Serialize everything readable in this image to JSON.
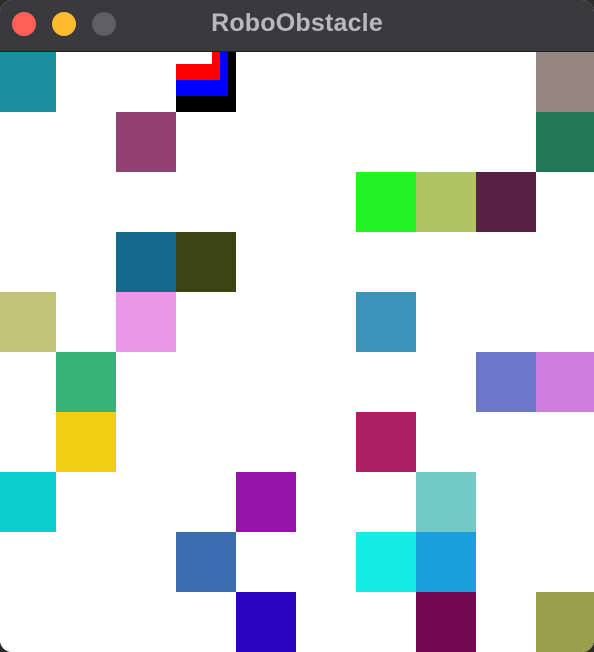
{
  "window": {
    "title": "RoboObstacle"
  },
  "grid": {
    "rows": 10,
    "cols": 10,
    "robot": {
      "row": 0,
      "col": 3,
      "icon": "robot-marker-icon",
      "ring_colors": [
        "#000000",
        "#0000ff",
        "#ff0000",
        "#ffffff",
        "#00ff00",
        "#ffffff"
      ]
    },
    "obstacles": [
      {
        "row": 0,
        "col": 0,
        "color": "#1a8fa0"
      },
      {
        "row": 0,
        "col": 9,
        "color": "#968682"
      },
      {
        "row": 1,
        "col": 2,
        "color": "#914171"
      },
      {
        "row": 1,
        "col": 9,
        "color": "#227757"
      },
      {
        "row": 2,
        "col": 6,
        "color": "#23f322"
      },
      {
        "row": 2,
        "col": 7,
        "color": "#b0c463"
      },
      {
        "row": 2,
        "col": 8,
        "color": "#572045"
      },
      {
        "row": 3,
        "col": 2,
        "color": "#136a8c"
      },
      {
        "row": 3,
        "col": 3,
        "color": "#3b4412"
      },
      {
        "row": 4,
        "col": 0,
        "color": "#c3c47b"
      },
      {
        "row": 4,
        "col": 2,
        "color": "#ea97ea"
      },
      {
        "row": 4,
        "col": 6,
        "color": "#3b94bc"
      },
      {
        "row": 5,
        "col": 1,
        "color": "#35b378"
      },
      {
        "row": 5,
        "col": 8,
        "color": "#6d78ca"
      },
      {
        "row": 5,
        "col": 9,
        "color": "#cf7ee0"
      },
      {
        "row": 6,
        "col": 1,
        "color": "#f4cd15"
      },
      {
        "row": 6,
        "col": 6,
        "color": "#ac1f63"
      },
      {
        "row": 7,
        "col": 0,
        "color": "#0acdcf"
      },
      {
        "row": 7,
        "col": 4,
        "color": "#9415a7"
      },
      {
        "row": 7,
        "col": 7,
        "color": "#72c9c6"
      },
      {
        "row": 8,
        "col": 3,
        "color": "#3c6db0"
      },
      {
        "row": 8,
        "col": 6,
        "color": "#15ebe7"
      },
      {
        "row": 8,
        "col": 7,
        "color": "#1ca0dd"
      },
      {
        "row": 9,
        "col": 4,
        "color": "#2904c1"
      },
      {
        "row": 9,
        "col": 7,
        "color": "#730854"
      },
      {
        "row": 9,
        "col": 9,
        "color": "#98a04e"
      }
    ]
  }
}
